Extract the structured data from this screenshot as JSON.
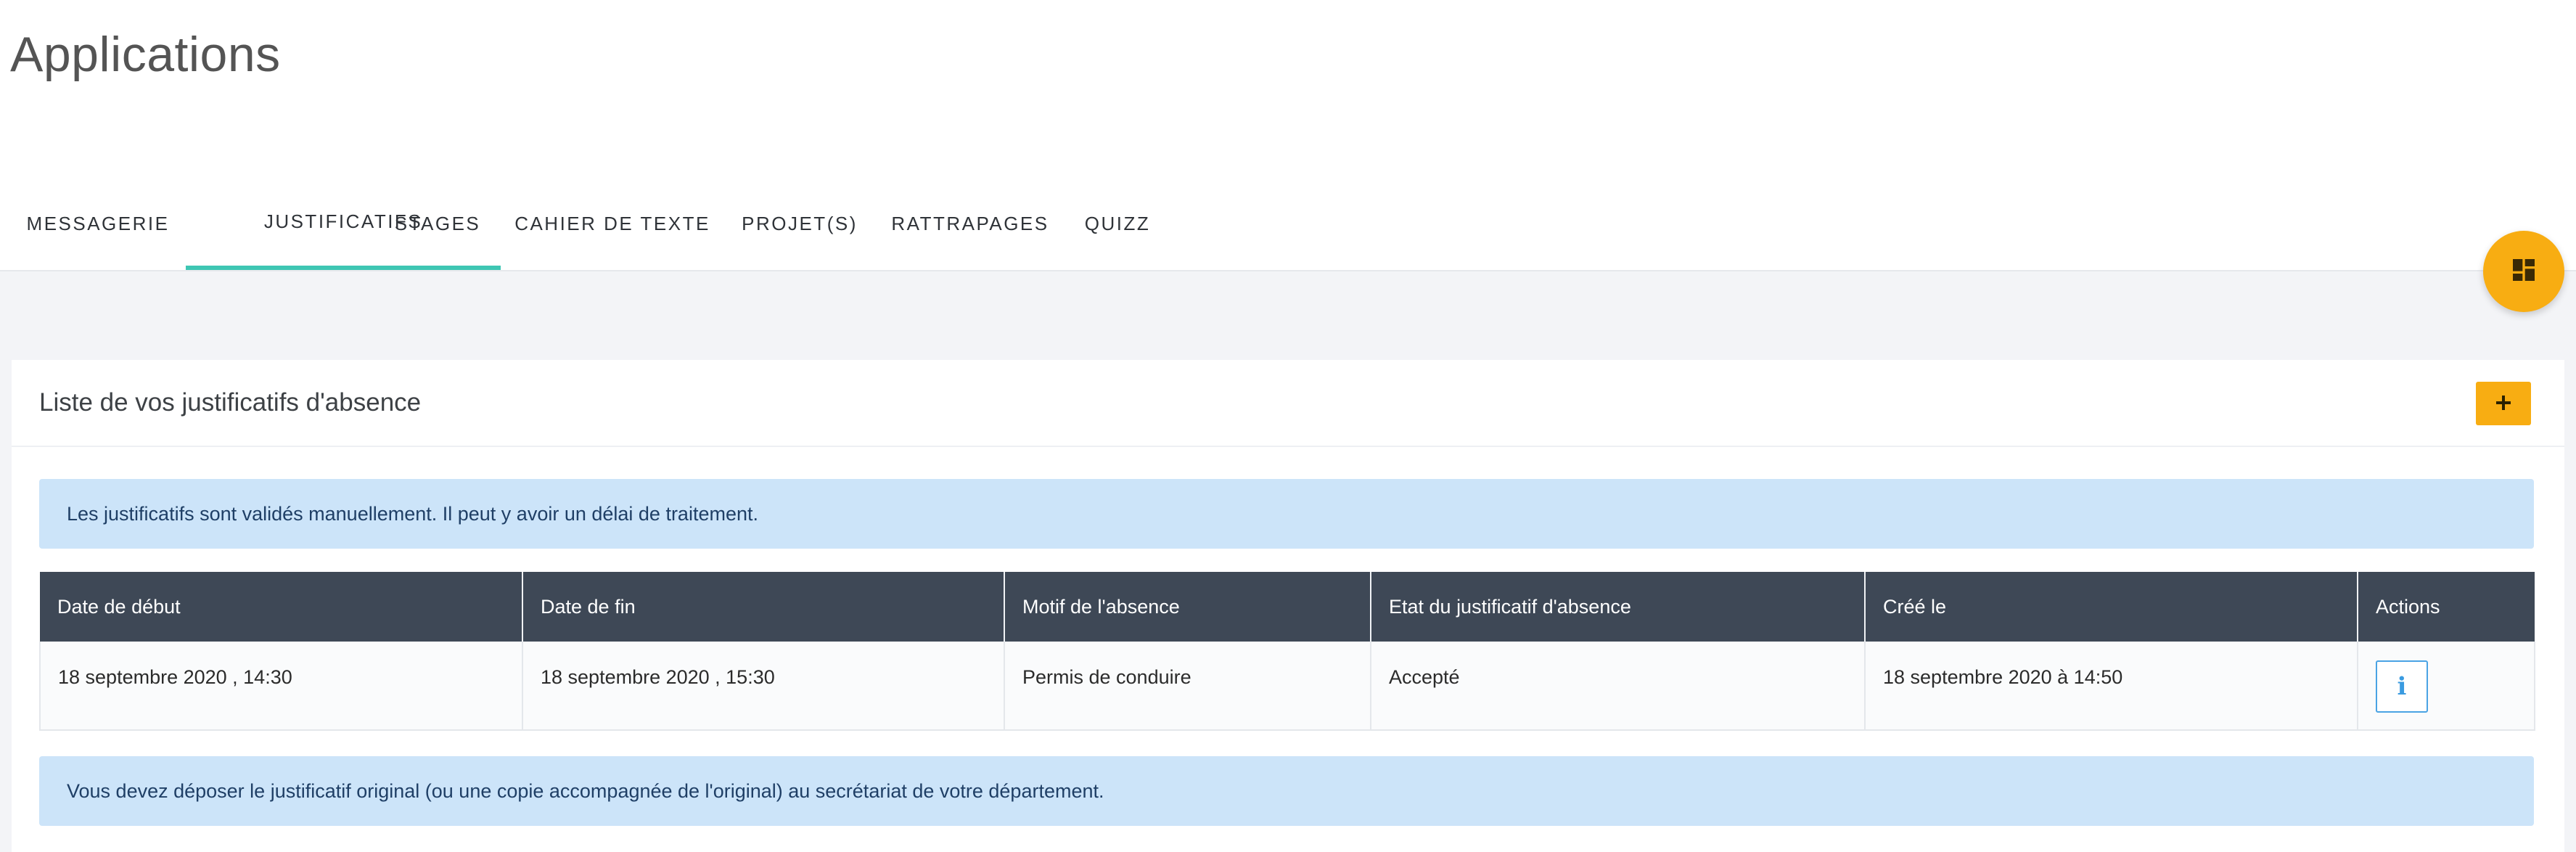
{
  "page": {
    "title": "Applications"
  },
  "tabs": [
    {
      "label": "MESSAGERIE",
      "active": false
    },
    {
      "label": "JUSTIFICATIFS",
      "active": true
    },
    {
      "label": "STAGES",
      "active": false
    },
    {
      "label": "CAHIER DE TEXTE",
      "active": false
    },
    {
      "label": "PROJET(S)",
      "active": false
    },
    {
      "label": "RATTRAPAGES",
      "active": false
    },
    {
      "label": "QUIZZ",
      "active": false
    }
  ],
  "fab": {
    "icon": "dashboard-icon"
  },
  "card": {
    "title": "Liste de vos justificatifs d'absence",
    "add_icon": "plus-icon",
    "info_alert": "Les justificatifs sont validés manuellement. Il peut y avoir un délai de traitement.",
    "footer_alert": "Vous devez déposer le justificatif original (ou une copie accompagnée de l'original) au secrétariat de votre département."
  },
  "table": {
    "headers": [
      "Date de début",
      "Date de fin",
      "Motif de l'absence",
      "Etat du justificatif d'absence",
      "Créé le",
      "Actions"
    ],
    "rows": [
      {
        "start": "18 septembre 2020 , 14:30",
        "end": "18 septembre 2020 , 15:30",
        "reason": "Permis de conduire",
        "status": "Accepté",
        "created": "18 septembre 2020 à 14:50",
        "action_icon": "info-icon"
      }
    ]
  },
  "colors": {
    "accent": "#f8ad12",
    "tab_indicator": "#3ec6b3",
    "table_header": "#3e4856",
    "alert_bg": "#cce4f9",
    "info_border": "#4aa3e4"
  }
}
